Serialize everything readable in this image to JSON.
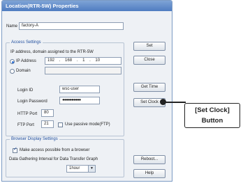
{
  "window": {
    "title": "Location(RTR-5W) Properties"
  },
  "name_field": {
    "label": "Name",
    "value": "factory-A"
  },
  "access_settings": {
    "title": "Access Settings",
    "description": "IP address, domain assigned to the RTR-5W",
    "ip_option": {
      "label": "IP Address",
      "selected": true
    },
    "ip_octets": [
      "192",
      "168",
      "1",
      "10"
    ],
    "domain_option": {
      "label": "Domain",
      "selected": false
    },
    "login_id": {
      "label": "Login ID",
      "value": "wsc-user"
    },
    "login_password": {
      "label": "Login Password",
      "value": "●●●●●●●●●●"
    },
    "http_port": {
      "label": "HTTP Port",
      "value": "80"
    },
    "ftp_port": {
      "label": "FTP Port",
      "value": "21"
    },
    "passive_mode": {
      "label": "Use passive mode(FTP)",
      "checked": false
    }
  },
  "browser_settings": {
    "title": "Browser Display Settings",
    "make_access": {
      "label": "Make access possible from a browser",
      "checked": true
    },
    "interval_label": "Data Gathering Interval for Data Transfer Graph",
    "interval_value": "1hour"
  },
  "buttons": {
    "set": "Set",
    "close": "Close",
    "get_time": "Get Time",
    "set_clock": "Set Clock",
    "reboot": "Reboot...",
    "help": "Help"
  },
  "callout": {
    "line1": "[Set Clock]",
    "line2": "Button"
  },
  "colors": {
    "titlebar": "#4f7cc1",
    "group_title": "#1d4c9d"
  }
}
